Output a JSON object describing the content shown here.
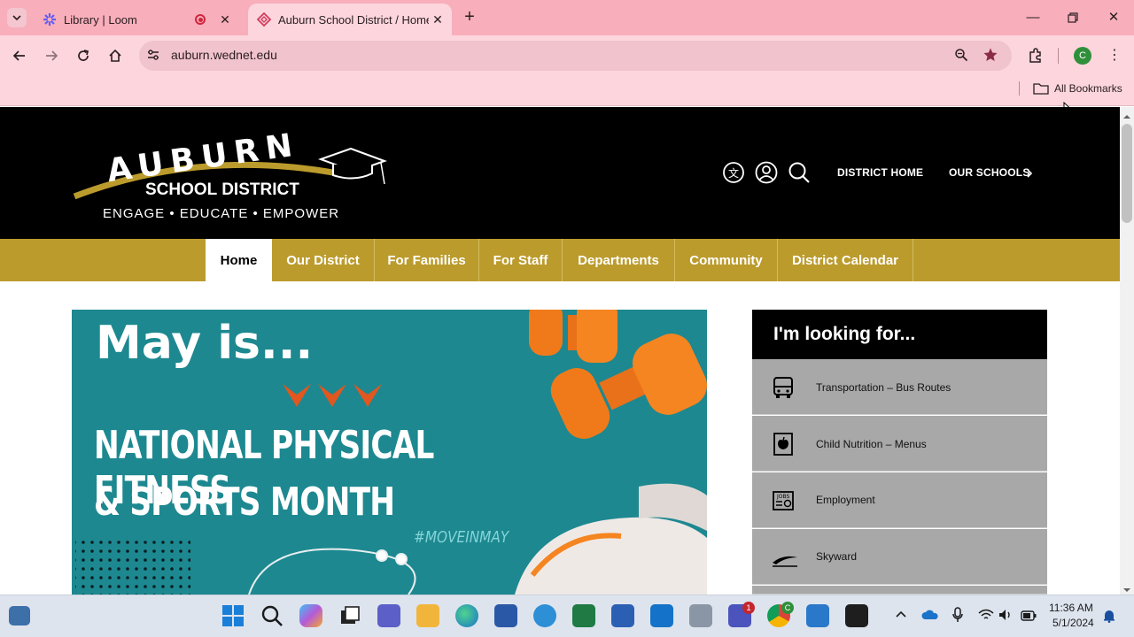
{
  "browser": {
    "tabs": [
      {
        "title": "Library | Loom"
      },
      {
        "title": "Auburn School District / Homep"
      }
    ],
    "url": "auburn.wednet.edu",
    "profile_initial": "C",
    "bookmarks_label": "All Bookmarks"
  },
  "site": {
    "logo": {
      "word": "AUBURN",
      "subtitle": "SCHOOL DISTRICT",
      "tagline": "ENGAGE • EDUCATE • EMPOWER"
    },
    "header_links": {
      "district_home": "DISTRICT HOME",
      "our_schools": "OUR SCHOOLS"
    },
    "nav": [
      {
        "label": "Home",
        "active": true
      },
      {
        "label": "Our District",
        "active": false
      },
      {
        "label": "For Families",
        "active": false
      },
      {
        "label": "For Staff",
        "active": false
      },
      {
        "label": "Departments",
        "active": false
      },
      {
        "label": "Community",
        "active": false
      },
      {
        "label": "District Calendar",
        "active": false
      }
    ],
    "hero": {
      "title": "May is...",
      "line1": "NATIONAL PHYSICAL FITNESS",
      "line2": "& SPORTS MONTH",
      "hashtag": "#MOVEINMAY"
    },
    "looking_for": {
      "title": "I'm looking for...",
      "items": [
        {
          "label": "Transportation – Bus Routes",
          "icon": "bus-icon"
        },
        {
          "label": "Child Nutrition – Menus",
          "icon": "apple-icon"
        },
        {
          "label": "Employment",
          "icon": "jobs-icon"
        },
        {
          "label": "Skyward",
          "icon": "skyward-icon"
        }
      ]
    }
  },
  "taskbar": {
    "time": "11:36 AM",
    "date": "5/1/2024",
    "teams_badge": "1",
    "chrome_badge": "C"
  },
  "colors": {
    "accent_gold": "#bb9b2c",
    "header_black": "#000000",
    "chrome_pink": "#f8aebb",
    "hero_teal": "#1d8890"
  }
}
